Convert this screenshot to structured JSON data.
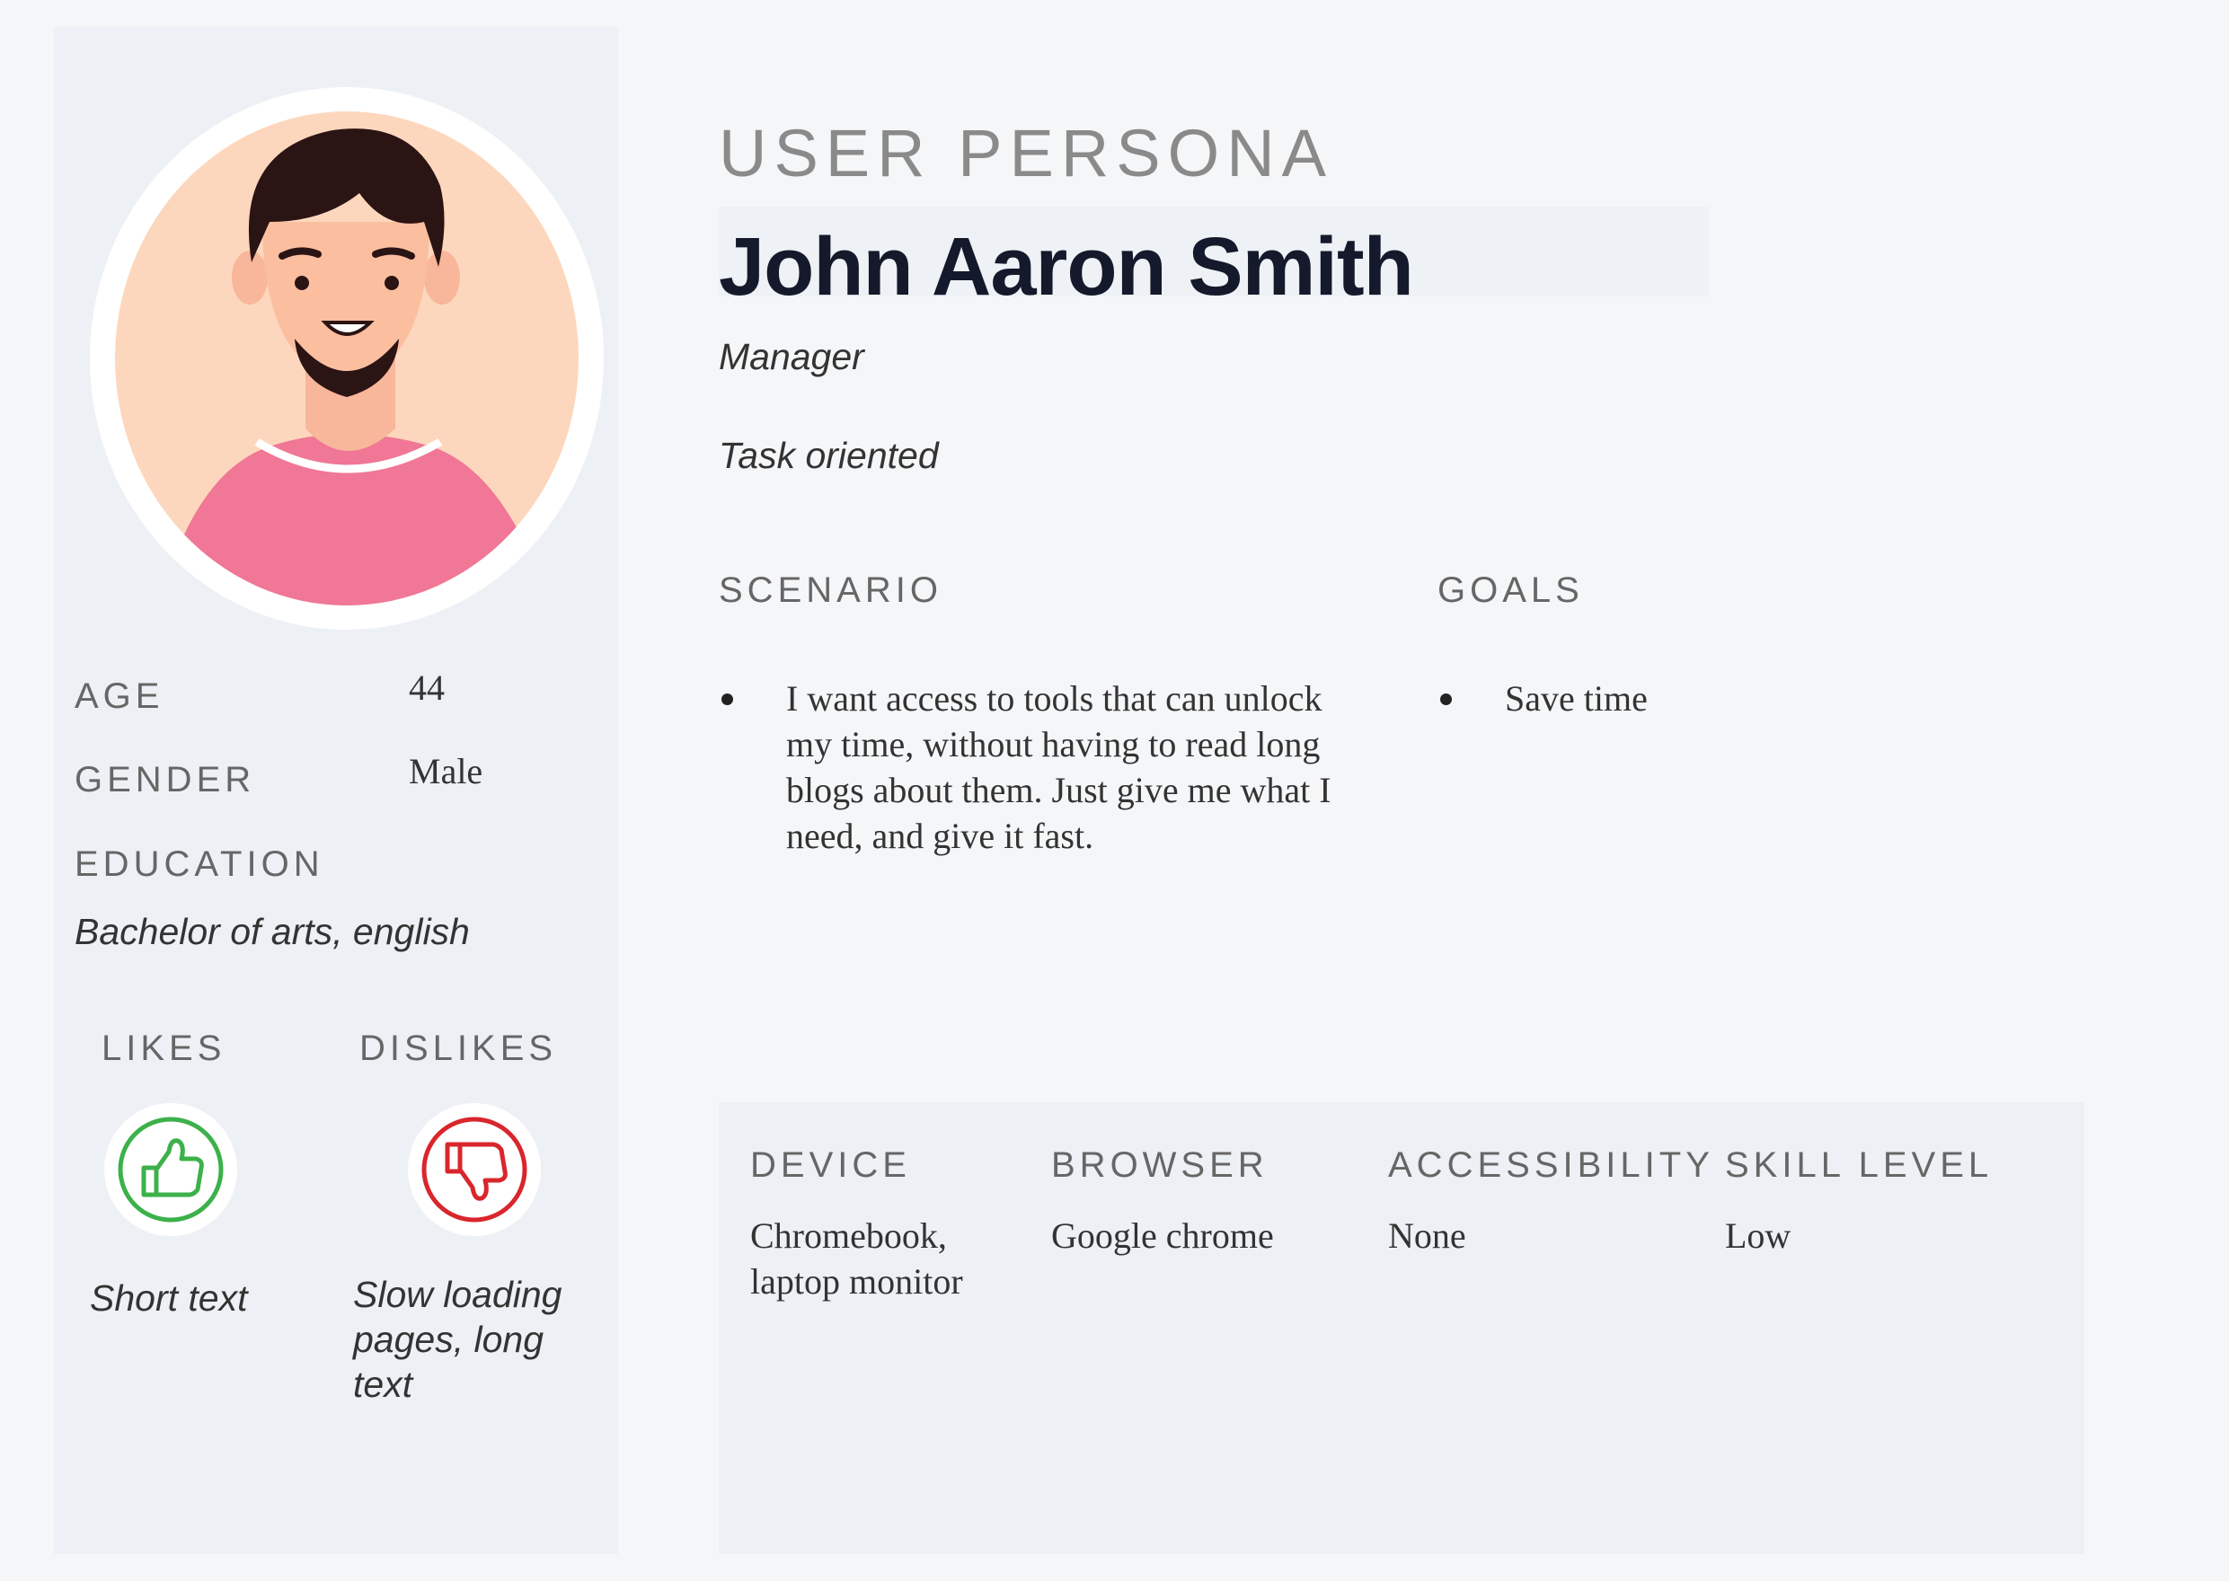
{
  "eyebrow": "USER PERSONA",
  "name": "John Aaron Smith",
  "role": "Manager",
  "trait": "Task oriented",
  "profile": {
    "age_label": "AGE",
    "age_value": "44",
    "gender_label": "GENDER",
    "gender_value": "Male",
    "education_label": "EDUCATION",
    "education_value": "Bachelor of arts, english",
    "likes_label": "LIKES",
    "dislikes_label": "DISLIKES",
    "likes_value": "Short text",
    "dislikes_value": [
      "Slow loading",
      "pages, long",
      "text"
    ]
  },
  "scenario": {
    "label": "SCENARIO",
    "lines": [
      "I want access to tools that can unlock",
      "my time, without having to read long",
      "blogs about them. Just give me what I",
      "need, and give it fast."
    ]
  },
  "goals": {
    "label": "GOALS",
    "items": [
      "Save time"
    ]
  },
  "specs": [
    {
      "label": "DEVICE",
      "value": [
        "Chromebook,",
        "laptop monitor"
      ]
    },
    {
      "label": "BROWSER",
      "value": [
        "Google chrome"
      ]
    },
    {
      "label": "ACCESSIBILITY",
      "value": [
        "None"
      ]
    },
    {
      "label": "SKILL LEVEL",
      "value": [
        "Low"
      ]
    }
  ],
  "icons": {
    "avatar": "man-avatar-illustration",
    "likes": "thumbs-up-icon",
    "dislikes": "thumbs-down-icon"
  },
  "colors": {
    "like": "#3cb14a",
    "dislike": "#d9262c",
    "shirt": "#f07795",
    "skin": "#fbbfa0"
  }
}
